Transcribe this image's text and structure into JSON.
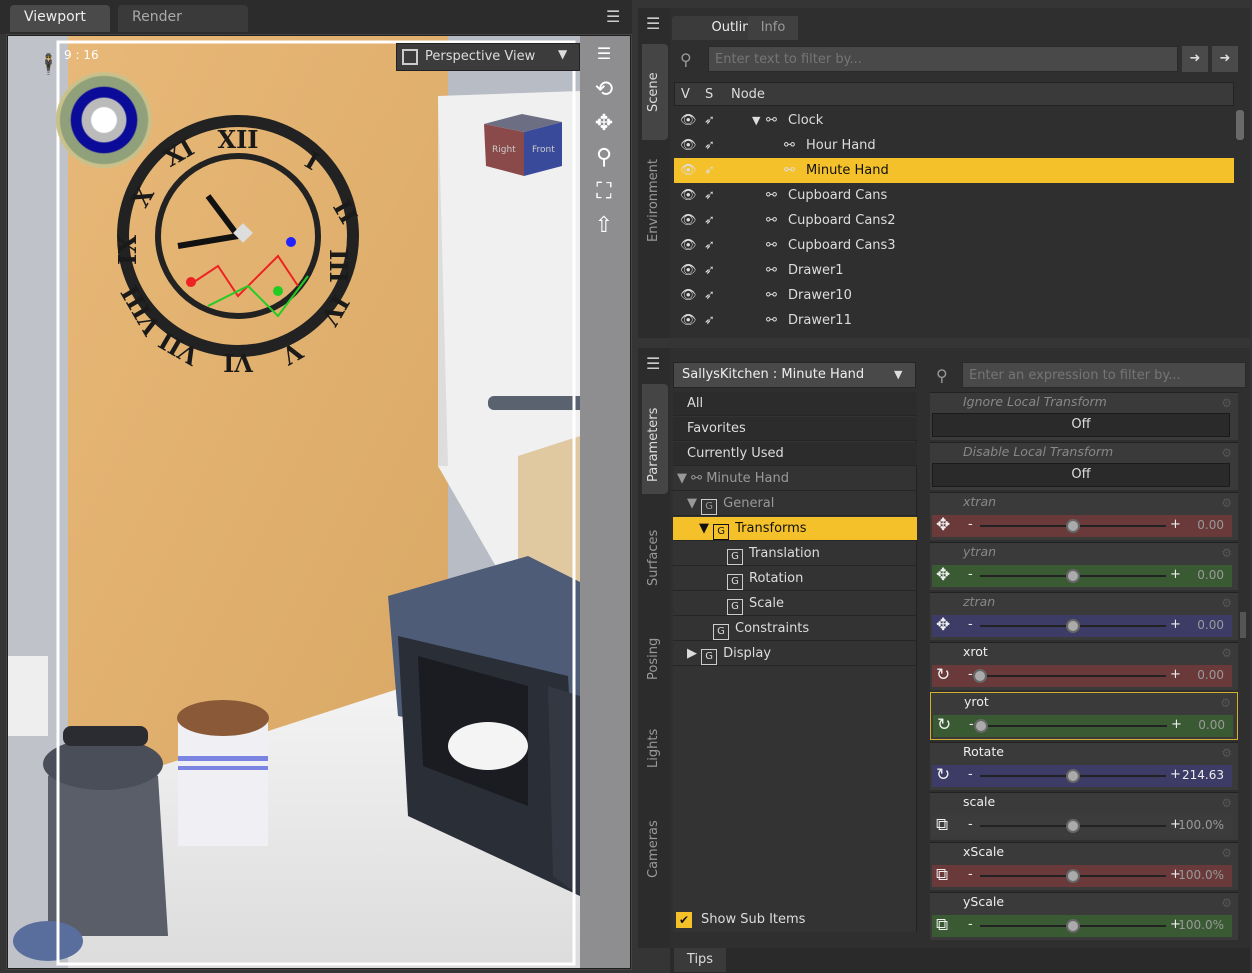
{
  "viewport_tabs": {
    "viewport": "Viewport",
    "render_library": "Render Library"
  },
  "viewport": {
    "view_select": "Perspective View",
    "aspect": "9 : 16",
    "cube_faces": {
      "right": "Right",
      "front": "Front"
    }
  },
  "side_tabs_top": {
    "scene": "Scene",
    "environment": "Environment"
  },
  "side_tabs_bottom": {
    "parameters": "Parameters",
    "surfaces": "Surfaces",
    "posing": "Posing",
    "lights": "Lights",
    "cameras": "Cameras"
  },
  "outline": {
    "tabs": [
      "Outline",
      "Info"
    ],
    "filter_placeholder": "Enter text to filter by...",
    "columns": {
      "v": "V",
      "s": "S",
      "node": "Node"
    },
    "rows": [
      {
        "label": "Clock"
      },
      {
        "label": "Hour Hand"
      },
      {
        "label": "Minute Hand"
      },
      {
        "label": "Cupboard Cans"
      },
      {
        "label": "Cupboard Cans2"
      },
      {
        "label": "Cupboard Cans3"
      },
      {
        "label": "Drawer1"
      },
      {
        "label": "Drawer10"
      },
      {
        "label": "Drawer11"
      }
    ]
  },
  "params": {
    "node_select": "SallysKitchen : Minute Hand",
    "filter_placeholder": "Enter an expression to filter by...",
    "tree": {
      "all": "All",
      "favorites": "Favorites",
      "currently_used": "Currently Used",
      "minute_hand": "Minute Hand",
      "general": "General",
      "transforms": "Transforms",
      "translation": "Translation",
      "rotation": "Rotation",
      "scale": "Scale",
      "constraints": "Constraints",
      "display": "Display"
    },
    "group_icon": "G",
    "show_sub_items": "Show Sub Items",
    "tips": "Tips",
    "properties": [
      {
        "label": "Ignore Local Transform",
        "value": "Off"
      },
      {
        "label": "Disable Local Transform",
        "value": "Off"
      },
      {
        "label": "xtran",
        "value": "0.00",
        "position": 0.5
      },
      {
        "label": "ytran",
        "value": "0.00",
        "position": 0.5
      },
      {
        "label": "ztran",
        "value": "0.00",
        "position": 0.5
      },
      {
        "label": "xrot",
        "value": "0.00",
        "position": 0.0
      },
      {
        "label": "yrot",
        "value": "0.00",
        "position": 0.0
      },
      {
        "label": "Rotate",
        "value": "214.63",
        "position": 0.5
      },
      {
        "label": "scale",
        "value": "100.0%",
        "position": 0.5
      },
      {
        "label": "xScale",
        "value": "100.0%",
        "position": 0.5
      },
      {
        "label": "yScale",
        "value": "100.0%",
        "position": 0.5
      }
    ]
  },
  "colors": {
    "selection": "#f5c12a",
    "panel": "#2f2f2f",
    "red_track": "#6a3a3a",
    "green_track": "#3a5a34",
    "blue_track": "#3c3c66"
  }
}
